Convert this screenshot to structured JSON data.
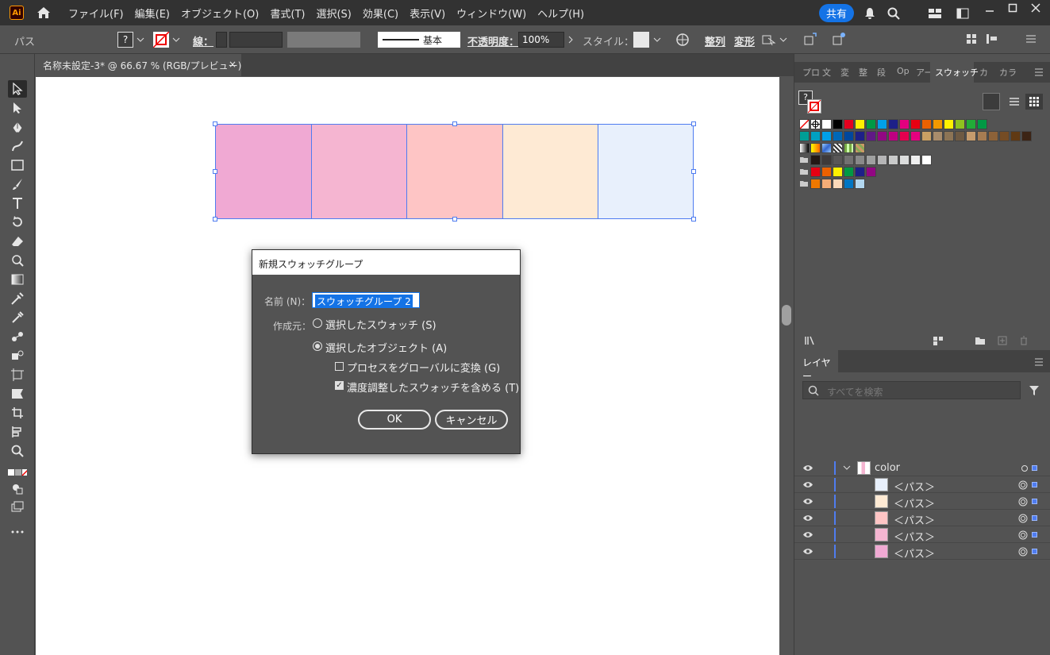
{
  "app": {
    "logo": "Ai"
  },
  "menu": [
    "ファイル(F)",
    "編集(E)",
    "オブジェクト(O)",
    "書式(T)",
    "選択(S)",
    "効果(C)",
    "表示(V)",
    "ウィンドウ(W)",
    "ヘルプ(H)"
  ],
  "share_label": "共有",
  "control": {
    "object_type": "パス",
    "fill_unknown": "?",
    "stroke_label": "線：",
    "brush_label": "基本",
    "opacity_label": "不透明度：",
    "opacity_value": "100%",
    "style_label": "スタイル：",
    "align_label": "整列",
    "transform_label": "変形"
  },
  "document_tab": {
    "title": "名称未設定-3* @ 66.67 % (RGB/プレビュー)",
    "close": "×"
  },
  "artwork": {
    "colors": [
      "#F0A9D3",
      "#F5B5D1",
      "#FEC5C5",
      "#FEEAD4",
      "#E8F0FC"
    ]
  },
  "dialog": {
    "title": "新規スウォッチグループ",
    "name_label": "名前 (N)：",
    "name_value": "スウォッチグループ 2",
    "source_label": "作成元：",
    "option_swatches": "選択したスウォッチ (S)",
    "option_objects": "選択したオブジェクト (A)",
    "selected_option": "objects",
    "check_global": "プロセスをグローバルに変換 (G)",
    "check_global_on": false,
    "check_tints": "濃度調整したスウォッチを含める (T)",
    "check_tints_on": true,
    "ok": "OK",
    "cancel": "キャンセル"
  },
  "swatch_panel": {
    "tabs": [
      "プロ",
      "文",
      "変",
      "整",
      "段",
      "Op",
      "アー",
      "スウォッチ",
      "カ",
      "カラ"
    ],
    "active_tab": "スウォッチ",
    "unknown": "?",
    "rows": [
      [
        "none",
        "reg",
        "#FFFFFF",
        "#000000",
        "#E6001F",
        "#FFF100",
        "#009944",
        "#00A0E9",
        "#1D2088",
        "#E4007F",
        "#E60012",
        "#EB6100",
        "#F39800",
        "#FFF100",
        "#8FC31F",
        "#22AC38",
        "#009944"
      ],
      [
        "#009E96",
        "#00A0C1",
        "#00A0E9",
        "#0068B7",
        "#00479D",
        "#1D2088",
        "#601986",
        "#920783",
        "#BE0081",
        "#E5004F",
        "#E5007F",
        "#C9A063",
        "#A88C6B",
        "#8C7455",
        "#6E5A43",
        "#C69C6D",
        "#A67C52",
        "#8C6239",
        "#754C24",
        "#603913",
        "#3C2415"
      ],
      [
        "grad1",
        "grad2",
        "grad3",
        "pat1",
        "pat2",
        "pat3"
      ],
      [
        "folder",
        "#231815",
        "#3E3A39",
        "#595757",
        "#727171",
        "#898989",
        "#9FA0A0",
        "#B5B5B6",
        "#C9CACA",
        "#DCDDDD",
        "#EFEFEF",
        "#FFFFFF"
      ],
      [
        "folder",
        "#E60012",
        "#EB6100",
        "#FFF100",
        "#009944",
        "#1D2088",
        "#920783"
      ],
      [
        "folder",
        "#EE7800",
        "#F6AD77",
        "#FCD9B9",
        "#0075C2",
        "#B2D7F0"
      ]
    ]
  },
  "layers_panel": {
    "tab": "レイヤー",
    "search_placeholder": "すべてを検索",
    "layer_name": "color",
    "paths": [
      {
        "name": "＜パス＞",
        "color": "#E8F0FC"
      },
      {
        "name": "＜パス＞",
        "color": "#FEEAD4"
      },
      {
        "name": "＜パス＞",
        "color": "#FEC5C5"
      },
      {
        "name": "＜パス＞",
        "color": "#F5B5D1"
      },
      {
        "name": "＜パス＞",
        "color": "#F0A9D3"
      }
    ]
  }
}
